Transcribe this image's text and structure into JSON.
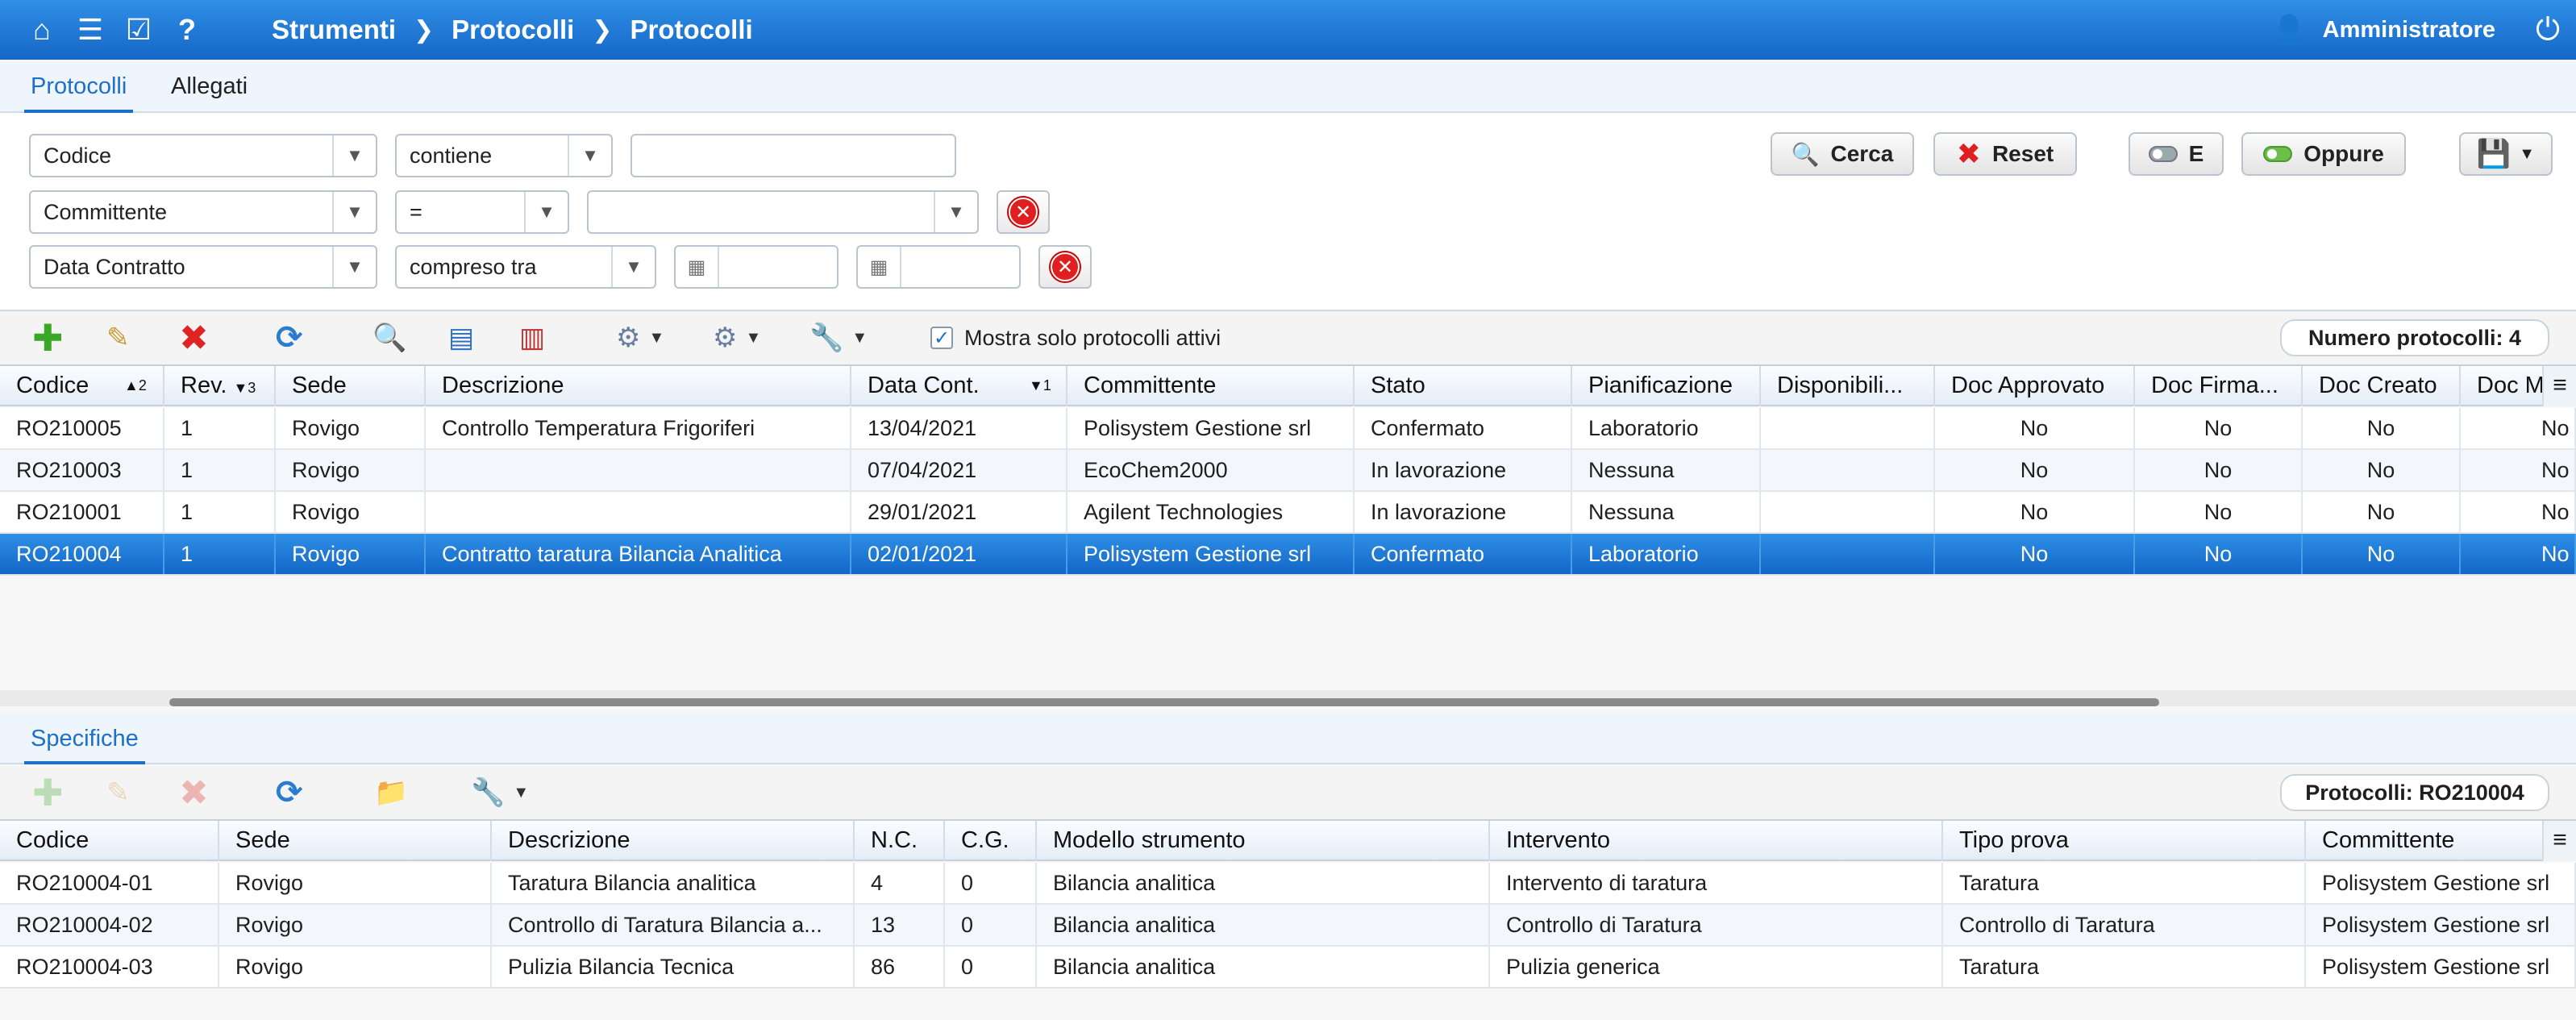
{
  "topbar": {
    "icons": [
      "home-icon",
      "menu-icon",
      "checklist-icon",
      "help-icon"
    ],
    "breadcrumb": [
      "Strumenti",
      "Protocolli",
      "Protocolli"
    ],
    "user": "Amministratore"
  },
  "tabs": [
    {
      "label": "Protocolli",
      "active": true
    },
    {
      "label": "Allegati",
      "active": false
    }
  ],
  "filters": {
    "row1": {
      "field": "Codice",
      "operator": "contiene",
      "value": ""
    },
    "row2": {
      "field": "Committente",
      "operator": "=",
      "value": ""
    },
    "row3": {
      "field": "Data Contratto",
      "operator": "compreso tra",
      "from": "",
      "to": ""
    },
    "buttons": {
      "search": "Cerca",
      "reset": "Reset",
      "and": "E",
      "or": "Oppure"
    }
  },
  "toolbar": {
    "active_only_label": "Mostra solo protocolli attivi",
    "active_only_checked": true,
    "count_label": "Numero protocolli: 4"
  },
  "protocols_grid": {
    "columns": [
      {
        "label": "Codice",
        "sort": "▲2"
      },
      {
        "label": "Rev.",
        "sort": "▼3"
      },
      {
        "label": "Sede"
      },
      {
        "label": "Descrizione"
      },
      {
        "label": "Data Cont.",
        "sort": "▼1"
      },
      {
        "label": "Committente"
      },
      {
        "label": "Stato"
      },
      {
        "label": "Pianificazione"
      },
      {
        "label": "Disponibili..."
      },
      {
        "label": "Doc Approvato"
      },
      {
        "label": "Doc Firma..."
      },
      {
        "label": "Doc Creato"
      },
      {
        "label": "Doc M"
      }
    ],
    "rows": [
      [
        "RO210005",
        "1",
        "Rovigo",
        "Controllo Temperatura Frigoriferi",
        "13/04/2021",
        "Polisystem Gestione srl",
        "Confermato",
        "Laboratorio",
        "",
        "No",
        "No",
        "No",
        "No"
      ],
      [
        "RO210003",
        "1",
        "Rovigo",
        "",
        "07/04/2021",
        "EcoChem2000",
        "In lavorazione",
        "Nessuna",
        "",
        "No",
        "No",
        "No",
        "No"
      ],
      [
        "RO210001",
        "1",
        "Rovigo",
        "",
        "29/01/2021",
        "Agilent Technologies",
        "In lavorazione",
        "Nessuna",
        "",
        "No",
        "No",
        "No",
        "No"
      ],
      [
        "RO210004",
        "1",
        "Rovigo",
        "Contratto taratura Bilancia Analitica",
        "02/01/2021",
        "Polisystem Gestione srl",
        "Confermato",
        "Laboratorio",
        "",
        "No",
        "No",
        "No",
        "No"
      ]
    ],
    "selected_row": 3
  },
  "spec_tab": {
    "label": "Specifiche"
  },
  "spec_toolbar": {
    "count_label": "Protocolli: RO210004"
  },
  "spec_grid": {
    "columns": [
      "Codice",
      "Sede",
      "Descrizione",
      "N.C.",
      "C.G.",
      "Modello strumento",
      "Intervento",
      "Tipo prova",
      "Committente"
    ],
    "rows": [
      [
        "RO210004-01",
        "Rovigo",
        "Taratura Bilancia analitica",
        "4",
        "0",
        "Bilancia analitica",
        "Intervento di taratura",
        "Taratura",
        "Polisystem Gestione srl"
      ],
      [
        "RO210004-02",
        "Rovigo",
        "Controllo di Taratura Bilancia a...",
        "13",
        "0",
        "Bilancia analitica",
        "Controllo di Taratura",
        "Controllo di Taratura",
        "Polisystem Gestione srl"
      ],
      [
        "RO210004-03",
        "Rovigo",
        "Pulizia Bilancia Tecnica",
        "86",
        "0",
        "Bilancia analitica",
        "Pulizia generica",
        "Taratura",
        "Polisystem Gestione srl"
      ]
    ]
  },
  "colors": {
    "accent": "#1e6fc8",
    "topbar": "#1a74d6",
    "selected_row": "#1a74d6",
    "delete": "#e02020",
    "add": "#3aa827"
  }
}
